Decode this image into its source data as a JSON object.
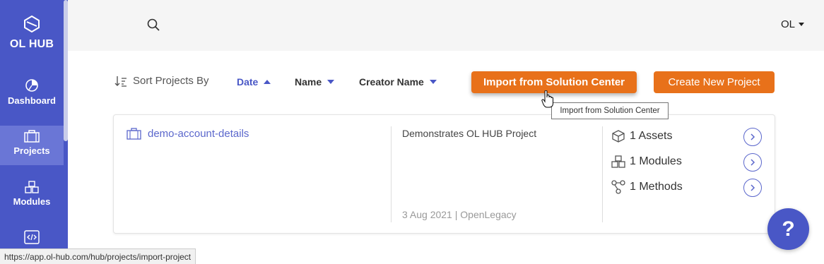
{
  "sidebar": {
    "logo_text": "OL HUB",
    "items": [
      {
        "label": "Dashboard",
        "icon": "dashboard-icon"
      },
      {
        "label": "Projects",
        "icon": "briefcase-icon",
        "active": true
      },
      {
        "label": "Modules",
        "icon": "cubes-icon"
      },
      {
        "label": "",
        "icon": "code-icon"
      }
    ]
  },
  "header": {
    "user_initials": "OL"
  },
  "sort": {
    "label": "Sort Projects By",
    "options": [
      {
        "label": "Date",
        "direction": "asc",
        "active": true
      },
      {
        "label": "Name",
        "direction": "desc"
      },
      {
        "label": "Creator Name",
        "direction": "desc"
      }
    ]
  },
  "actions": {
    "import_label": "Import from Solution Center",
    "create_label": "Create New Project",
    "import_tooltip": "Import from Solution Center"
  },
  "projects": [
    {
      "name": "demo-account-details",
      "description": "Demonstrates OL HUB Project",
      "meta": "3 Aug 2021 | OpenLegacy",
      "stats": [
        {
          "label": "1 Assets",
          "icon": "cube-icon"
        },
        {
          "label": "1 Modules",
          "icon": "cubes-icon"
        },
        {
          "label": "1 Methods",
          "icon": "methods-icon"
        }
      ]
    }
  ],
  "help": {
    "label": "?"
  },
  "status_bar": {
    "url": "https://app.ol-hub.com/hub/projects/import-project"
  },
  "colors": {
    "brand": "#4957c6",
    "accent": "#e8711a"
  }
}
